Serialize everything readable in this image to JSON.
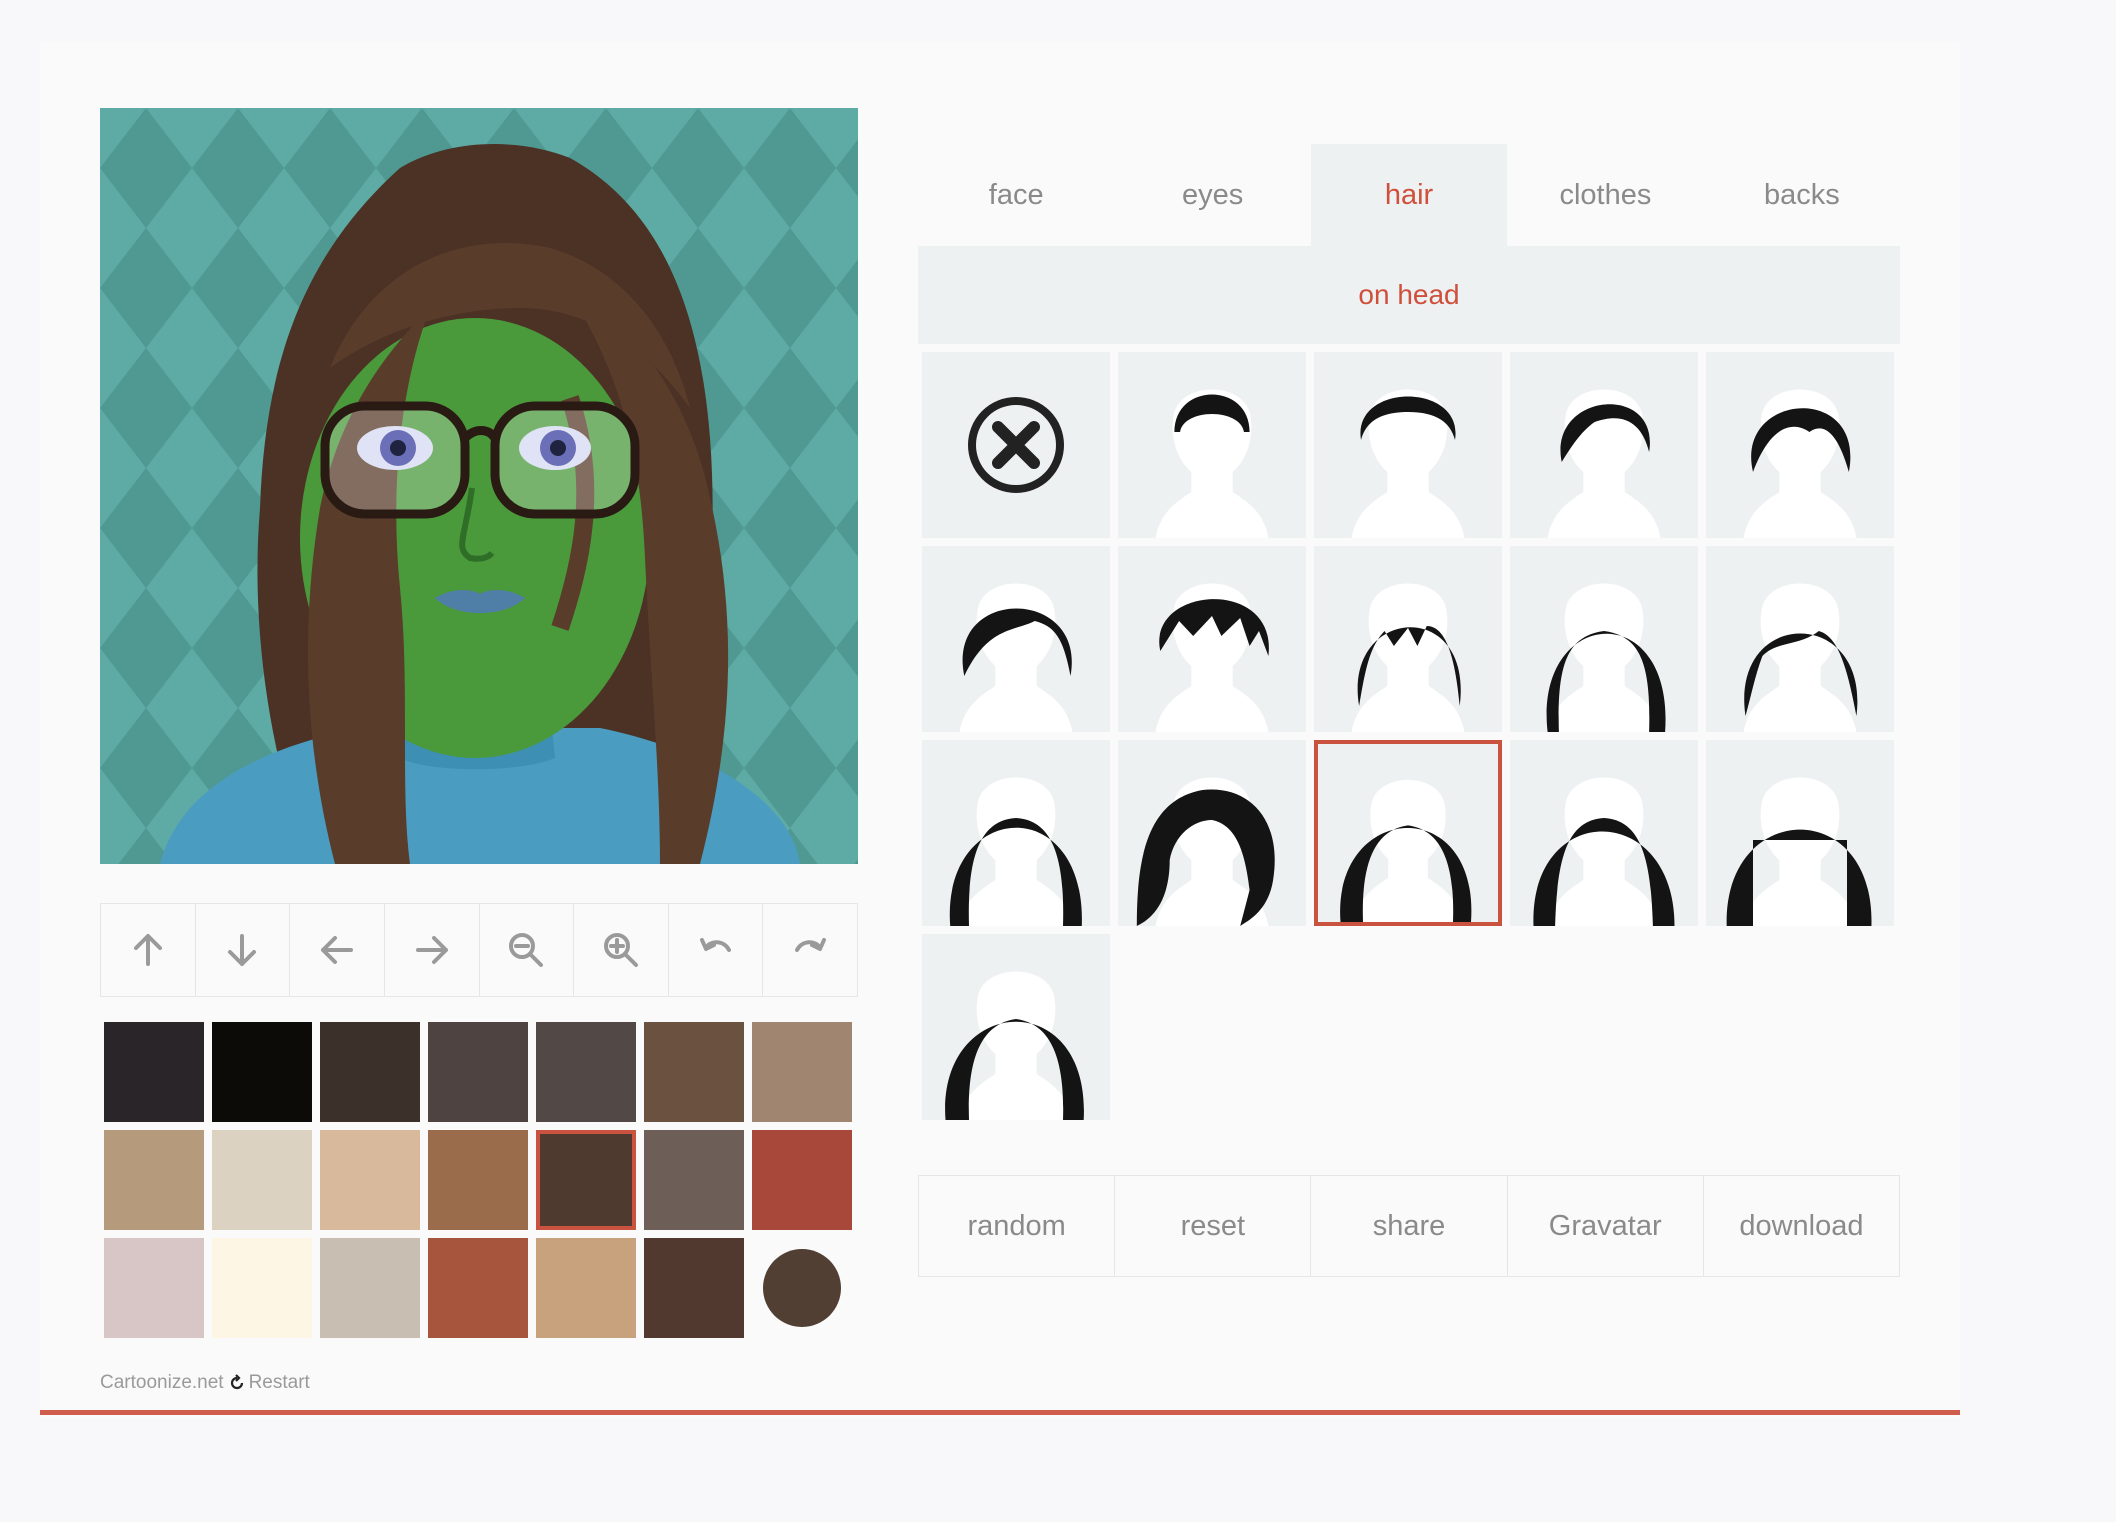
{
  "tabs": [
    {
      "label": "face"
    },
    {
      "label": "eyes"
    },
    {
      "label": "hair"
    },
    {
      "label": "clothes"
    },
    {
      "label": "backs"
    }
  ],
  "active_tab": "hair",
  "subtab": {
    "label": "on head"
  },
  "actions": {
    "random": "random",
    "reset": "reset",
    "share": "share",
    "gravatar": "Gravatar",
    "download": "download"
  },
  "toolbar": [
    "arrow-up-icon",
    "arrow-down-icon",
    "arrow-left-icon",
    "arrow-right-icon",
    "zoom-out-icon",
    "zoom-in-icon",
    "undo-icon",
    "redo-icon"
  ],
  "colors": {
    "accent": "#cf5b4a",
    "swatches": [
      "#2a2529",
      "#0c0b07",
      "#3b302a",
      "#4e4340",
      "#524845",
      "#6a5140",
      "#a08570",
      "#b59a7c",
      "#dcd2c1",
      "#d9b99b",
      "#9b6c4b",
      "#4e3a2e",
      "#6d5f57",
      "#a8483a",
      "#d8c6c6",
      "#fdf6e5",
      "#c8bfb2",
      "#a8553e",
      "#c7a27c",
      "#523930",
      "#523f33"
    ],
    "selected_swatch_index": 11
  },
  "hair_styles": {
    "count": 16,
    "selected_index": 12
  },
  "footer": {
    "site": "Cartoonize.net",
    "restart": "Restart"
  }
}
